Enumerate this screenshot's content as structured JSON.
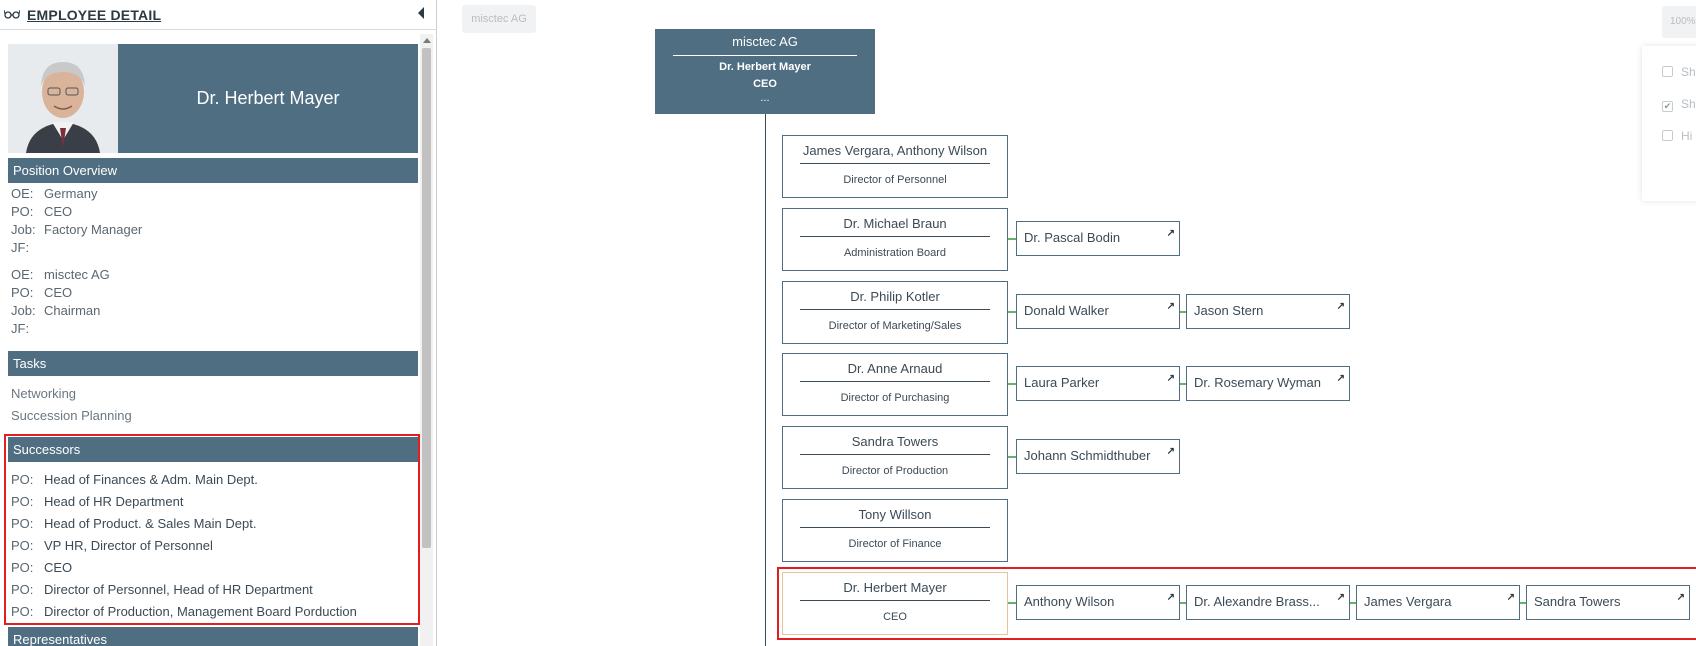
{
  "panel": {
    "title": "EMPLOYEE DETAIL",
    "icon": "glasses-icon",
    "collapse_icon": "chevron-left-icon"
  },
  "profile": {
    "name": "Dr. Herbert Mayer"
  },
  "position_overview": {
    "title": "Position Overview",
    "group1": [
      {
        "key": "OE:",
        "value": "Germany"
      },
      {
        "key": "PO:",
        "value": "CEO"
      },
      {
        "key": "Job:",
        "value": "Factory Manager"
      },
      {
        "key": "JF:",
        "value": ""
      }
    ],
    "group2": [
      {
        "key": "OE:",
        "value": "misctec AG"
      },
      {
        "key": "PO:",
        "value": "CEO"
      },
      {
        "key": "Job:",
        "value": "Chairman"
      },
      {
        "key": "JF:",
        "value": ""
      }
    ]
  },
  "tasks": {
    "title": "Tasks",
    "items": [
      "Networking",
      "Succession Planning"
    ]
  },
  "successors": {
    "title": "Successors",
    "items": [
      {
        "key": "PO:",
        "value": "Head of Finances & Adm. Main Dept."
      },
      {
        "key": "PO:",
        "value": "Head of HR Department"
      },
      {
        "key": "PO:",
        "value": "Head of Product. & Sales Main Dept."
      },
      {
        "key": "PO:",
        "value": "VP HR, Director of Personnel"
      },
      {
        "key": "PO:",
        "value": "CEO"
      },
      {
        "key": "PO:",
        "value": "Director of Personnel, Head of HR Department"
      },
      {
        "key": "PO:",
        "value": "Director of Production, Management Board Porduction"
      }
    ]
  },
  "representatives": {
    "title": "Representatives"
  },
  "toolbar": {
    "breadcrumb": "misctec AG",
    "zoom": "100%"
  },
  "options": {
    "items": [
      {
        "label": "Sh",
        "checked": false
      },
      {
        "label": "Sh",
        "checked": true
      },
      {
        "label": "Hi",
        "checked": false
      }
    ]
  },
  "root": {
    "org": "misctec AG",
    "name": "Dr. Herbert Mayer",
    "position": "CEO",
    "more": "..."
  },
  "nodes": [
    {
      "name": "James Vergara, Anthony Wilson",
      "position": "Director of Personnel",
      "successors": []
    },
    {
      "name": "Dr. Michael Braun",
      "position": "Administration Board",
      "successors": [
        "Dr. Pascal Bodin"
      ]
    },
    {
      "name": "Dr. Philip Kotler",
      "position": "Director of Marketing/Sales",
      "successors": [
        "Donald Walker",
        "Jason Stern"
      ]
    },
    {
      "name": "Dr. Anne Arnaud",
      "position": "Director of Purchasing",
      "successors": [
        "Laura Parker",
        "Dr. Rosemary Wyman"
      ]
    },
    {
      "name": "Sandra Towers",
      "position": "Director of Production",
      "successors": [
        "Johann Schmidthuber"
      ]
    },
    {
      "name": "Tony Willson",
      "position": "Director of Finance",
      "successors": []
    },
    {
      "name": "Dr. Herbert Mayer",
      "position": "CEO",
      "successors": [
        "Anthony Wilson",
        "Dr. Alexandre Brass...",
        "James Vergara",
        "Sandra Towers"
      ]
    }
  ],
  "colors": {
    "accent": "#506e82",
    "highlight": "#e02020",
    "connector": "#66b266",
    "selected_border": "#e4c29a"
  }
}
